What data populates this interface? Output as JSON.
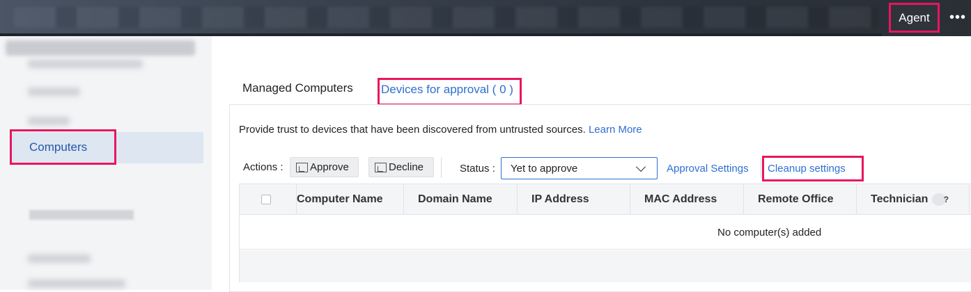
{
  "header": {
    "agent_label": "Agent",
    "more_label": "•••"
  },
  "sidebar": {
    "active_item": "Computers"
  },
  "tabs": {
    "managed": "Managed Computers",
    "devices": "Devices for approval ( 0 )"
  },
  "info": {
    "text": "Provide trust to devices that have been discovered from untrusted sources.",
    "link": "Learn More"
  },
  "toolbar": {
    "actions_label": "Actions :",
    "approve_label": "Approve",
    "decline_label": "Decline",
    "status_label": "Status :",
    "status_value": "Yet to approve",
    "approval_settings": "Approval Settings",
    "cleanup_settings": "Cleanup settings"
  },
  "table": {
    "columns": [
      "Computer Name",
      "Domain Name",
      "IP Address",
      "MAC Address",
      "Remote Office",
      "Technician"
    ],
    "help_icon": "?",
    "empty_text": "No computer(s) added"
  },
  "colors": {
    "highlight": "#e8165e",
    "link": "#2d6fd1",
    "active_text": "#2458a8"
  }
}
